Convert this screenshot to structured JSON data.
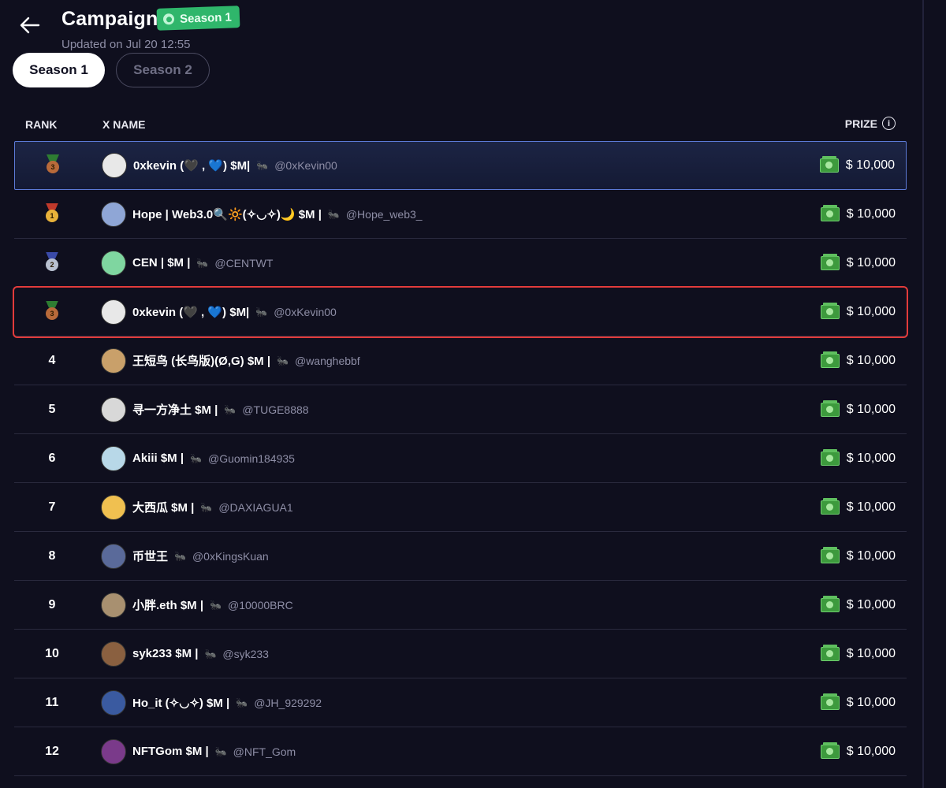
{
  "header": {
    "title": "Campaign",
    "badge": "Season 1",
    "updated": "Updated on Jul 20 12:55"
  },
  "tabs": [
    {
      "label": "Season 1",
      "active": true
    },
    {
      "label": "Season 2",
      "active": false
    }
  ],
  "table": {
    "columns": {
      "rank": "RANK",
      "name": "X NAME",
      "prize": "PRIZE"
    },
    "rows": [
      {
        "rank": "",
        "medal": "bronze",
        "name": "0xkevin (🖤 , 💙) $M|",
        "handle": "@0xKevin00",
        "prize": "$ 10,000",
        "avatar_color": "#e8e8e8"
      },
      {
        "rank": "",
        "medal": "gold",
        "name": "Hope | Web3.0🔍🔆(✧◡✧)🌙 $M |",
        "handle": "@Hope_web3_",
        "prize": "$ 10,000",
        "avatar_color": "#8fa6d6"
      },
      {
        "rank": "",
        "medal": "silver",
        "name": "CEN | $M |",
        "handle": "@CENTWT",
        "prize": "$ 10,000",
        "avatar_color": "#7fd6a0"
      },
      {
        "rank": "",
        "medal": "bronze",
        "name": "0xkevin (🖤 , 💙) $M|",
        "handle": "@0xKevin00",
        "prize": "$ 10,000",
        "avatar_color": "#e8e8e8"
      },
      {
        "rank": "4",
        "medal": "",
        "name": "王短鸟 (长鸟版)(Ø,G) $M |",
        "handle": "@wanghebbf",
        "prize": "$ 10,000",
        "avatar_color": "#c9a06a"
      },
      {
        "rank": "5",
        "medal": "",
        "name": "寻一方净土 $M |",
        "handle": "@TUGE8888",
        "prize": "$ 10,000",
        "avatar_color": "#d8d8d8"
      },
      {
        "rank": "6",
        "medal": "",
        "name": "Akiii $M |",
        "handle": "@Guomin184935",
        "prize": "$ 10,000",
        "avatar_color": "#b8d8e8"
      },
      {
        "rank": "7",
        "medal": "",
        "name": "大西瓜 $M |",
        "handle": "@DAXIAGUA1",
        "prize": "$ 10,000",
        "avatar_color": "#f0c050"
      },
      {
        "rank": "8",
        "medal": "",
        "name": "币世王",
        "handle": "@0xKingsKuan",
        "prize": "$ 10,000",
        "avatar_color": "#5a6a9a"
      },
      {
        "rank": "9",
        "medal": "",
        "name": "小胖.eth $M |",
        "handle": "@10000BRC",
        "prize": "$ 10,000",
        "avatar_color": "#a89070"
      },
      {
        "rank": "10",
        "medal": "",
        "name": "syk233 $M |",
        "handle": "@syk233",
        "prize": "$ 10,000",
        "avatar_color": "#8a6040"
      },
      {
        "rank": "11",
        "medal": "",
        "name": "Ho_it (✧◡✧) $M |",
        "handle": "@JH_929292",
        "prize": "$ 10,000",
        "avatar_color": "#3a5aa0"
      },
      {
        "rank": "12",
        "medal": "",
        "name": "NFTGom $M |",
        "handle": "@NFT_Gom",
        "prize": "$ 10,000",
        "avatar_color": "#7a3a8a"
      }
    ]
  },
  "colors": {
    "background": "#0f0f1e",
    "badge": "#2fb66b",
    "highlight_border": "#5c7ad6",
    "annotation_box": "#e23b3b",
    "gold": "#e8b23a",
    "silver": "#b8c0d0",
    "bronze": "#b86a3a"
  }
}
